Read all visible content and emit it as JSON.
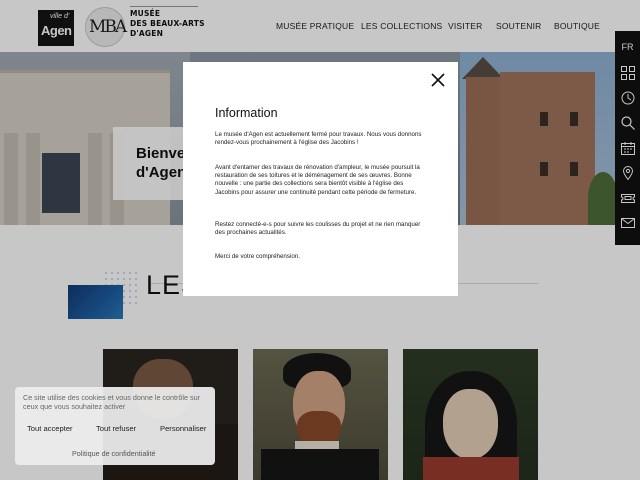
{
  "header": {
    "logo_ville": "ville d'",
    "logo_agen": "Agen",
    "mba_monogram": "MBA",
    "museum_name": [
      "MUSÉE",
      "DES BEAUX-ARTS",
      "D'AGEN"
    ],
    "nav": [
      "MUSÉE PRATIQUE",
      "LES COLLECTIONS",
      "VISITER",
      "SOUTENIR",
      "BOUTIQUE"
    ]
  },
  "hero": {
    "welcome_line1": "Bienve",
    "welcome_line2": "d'Agen"
  },
  "sidebar": {
    "language": "FR",
    "icons": [
      "grid-icon",
      "clock-icon",
      "search-icon",
      "calendar-icon",
      "location-icon",
      "ticket-icon",
      "newsletter-icon"
    ]
  },
  "collections": {
    "title_visible": "LES"
  },
  "modal": {
    "title": "Information",
    "paragraphs": [
      "Le musée d'Agen est actuellement fermé pour travaux. Nous vous donnons rendez-vous prochainement à l'église des Jacobins !",
      "Avant d'entamer des travaux de rénovation d'ampleur, le musée poursuit la restauration de ses toitures et le déménagement de ses œuvres. Bonne nouvelle : une partie des collections sera bientôt visible à l'église des Jacobins pour assurer une continuité pendant cette période de fermeture.",
      "Restez connecté-e-s pour suivre les coulisses du projet et ne rien manquer des prochaines actualités.",
      "Merci de votre compréhension."
    ]
  },
  "cookie": {
    "text": "Ce site utilise des cookies et vous donne le contrôle sur ceux que vous souhaitez activer",
    "accept": "Tout accepter",
    "refuse": "Tout refuser",
    "customize": "Personnaliser",
    "policy": "Politique de confidentialité"
  },
  "colors": {
    "accent_blue": "#1d5ea3",
    "sidebar_bg": "#111111",
    "overlay": "rgba(0,0,0,0.22)"
  }
}
